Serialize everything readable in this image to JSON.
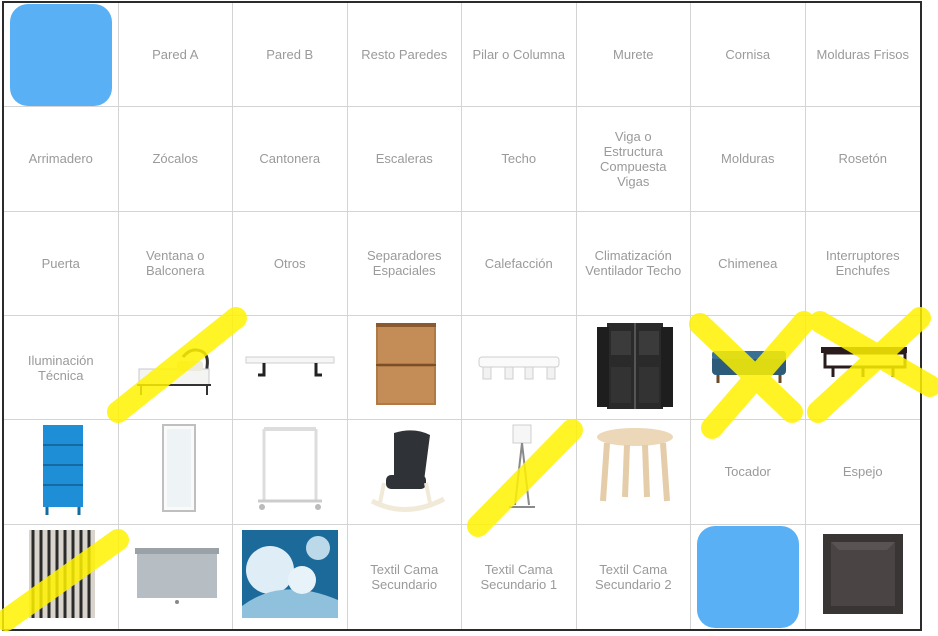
{
  "board": {
    "cells": [
      {
        "type": "blank",
        "color": "#5ab0f5",
        "name": "selected-tile"
      },
      {
        "type": "text",
        "label": "Pared A"
      },
      {
        "type": "text",
        "label": "Pared B"
      },
      {
        "type": "text",
        "label": "Resto Paredes"
      },
      {
        "type": "text",
        "label": "Pilar o Columna"
      },
      {
        "type": "text",
        "label": "Murete"
      },
      {
        "type": "text",
        "label": "Cornisa"
      },
      {
        "type": "text",
        "label": "Molduras Frisos"
      },
      {
        "type": "text",
        "label": "Arrimadero"
      },
      {
        "type": "text",
        "label": "Zócalos"
      },
      {
        "type": "text",
        "label": "Cantonera"
      },
      {
        "type": "text",
        "label": "Escaleras"
      },
      {
        "type": "text",
        "label": "Techo"
      },
      {
        "type": "text",
        "label": "Viga o\nEstructura\nCompuesta\nVigas"
      },
      {
        "type": "text",
        "label": "Molduras"
      },
      {
        "type": "text",
        "label": "Rosetón"
      },
      {
        "type": "text",
        "label": "Puerta"
      },
      {
        "type": "text",
        "label": "Ventana o\nBalconera"
      },
      {
        "type": "text",
        "label": "Otros"
      },
      {
        "type": "text",
        "label": "Separadores\nEspaciales"
      },
      {
        "type": "text",
        "label": "Calefacción"
      },
      {
        "type": "text",
        "label": "Climatización\nVentilador Techo"
      },
      {
        "type": "text",
        "label": "Chimenea"
      },
      {
        "type": "text",
        "label": "Interruptores\nEnchufes"
      },
      {
        "type": "text",
        "label": "Iluminación\nTécnica"
      },
      {
        "type": "image",
        "icon": "bed-icon"
      },
      {
        "type": "image",
        "icon": "wall-shelf-icon"
      },
      {
        "type": "image",
        "icon": "nightstand-icon"
      },
      {
        "type": "image",
        "icon": "low-bench-icon"
      },
      {
        "type": "image",
        "icon": "wardrobe-icon"
      },
      {
        "type": "image",
        "icon": "storage-bench-icon"
      },
      {
        "type": "image",
        "icon": "coat-rack-shelf-icon"
      },
      {
        "type": "image",
        "icon": "drawer-cabinet-icon"
      },
      {
        "type": "image",
        "icon": "floor-mirror-icon"
      },
      {
        "type": "image",
        "icon": "clothes-rack-icon"
      },
      {
        "type": "image",
        "icon": "rocking-chair-icon"
      },
      {
        "type": "image",
        "icon": "floor-lamp-icon"
      },
      {
        "type": "image",
        "icon": "stool-icon"
      },
      {
        "type": "text",
        "label": "Tocador"
      },
      {
        "type": "text",
        "label": "Espejo"
      },
      {
        "type": "image",
        "icon": "striped-rug-icon"
      },
      {
        "type": "image",
        "icon": "roller-blind-icon"
      },
      {
        "type": "image",
        "icon": "duvet-cover-icon"
      },
      {
        "type": "text",
        "label": "Textil Cama\nSecundario"
      },
      {
        "type": "text",
        "label": "Textil Cama\nSecundario 1"
      },
      {
        "type": "text",
        "label": "Textil Cama\nSecundario 2"
      },
      {
        "type": "blank",
        "color": "#5ab0f5",
        "name": "blank-tile"
      },
      {
        "type": "image",
        "icon": "cube-shelf-icon"
      }
    ]
  },
  "highlight_color": "#fff200"
}
